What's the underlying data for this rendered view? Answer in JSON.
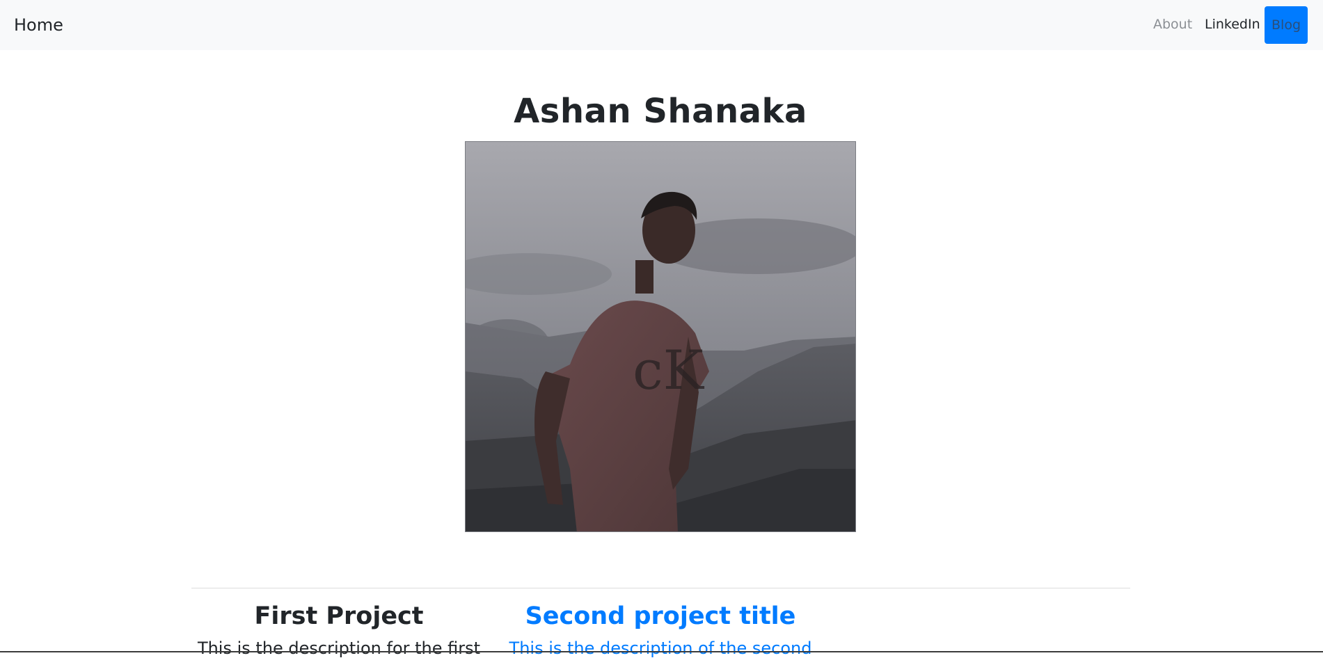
{
  "navbar": {
    "brand": "Home",
    "links": [
      {
        "label": "About"
      },
      {
        "label": "LinkedIn"
      },
      {
        "label": "Blog"
      }
    ]
  },
  "hero": {
    "title": "Ashan Shanaka",
    "photo_alt": "Profile photo"
  },
  "projects": [
    {
      "title": "First Project",
      "description": "This is the description for the first"
    },
    {
      "title": "Second project title",
      "description": "This is the description of the second"
    }
  ],
  "colors": {
    "navbar_bg": "#f8f9fa",
    "accent": "#007bff",
    "text": "#212529",
    "muted": "#8b8f94"
  }
}
